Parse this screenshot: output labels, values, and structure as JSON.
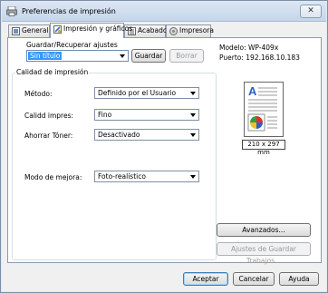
{
  "window": {
    "title": "Preferencias de impresión",
    "close": "✕"
  },
  "tabs": [
    {
      "label": "General"
    },
    {
      "label": "Impresión y gráficos"
    },
    {
      "label": "Acabado"
    },
    {
      "label": "Impresora"
    }
  ],
  "settings": {
    "save_label": "Guardar/Recuperar ajustes",
    "save_value": "Sin título",
    "save_button": "Guardar",
    "delete_button": "Borrar"
  },
  "device": {
    "model": "Modelo: WP-409x",
    "port": "Puerto: 192.168.10.183",
    "paper_size": "210 x 297 mm"
  },
  "quality": {
    "group_title": "Calidad de impresión",
    "method_label": "Método:",
    "method_value": "Definido por el Usuario",
    "quality_label": "Calidd impres:",
    "quality_value": "Fino",
    "toner_label": "Ahorrar Tóner:",
    "toner_value": "Desactivado",
    "enhance_label": "Modo de mejora:",
    "enhance_value": "Foto-realístico"
  },
  "side_buttons": {
    "advanced": "Avanzados...",
    "save_settings": "Ajustes de Guardar Trabajos..."
  },
  "footer": {
    "ok": "Aceptar",
    "cancel": "Cancelar",
    "help": "Ayuda"
  },
  "colors": {
    "accent": "#3399ff",
    "selection": "#3399ff"
  }
}
